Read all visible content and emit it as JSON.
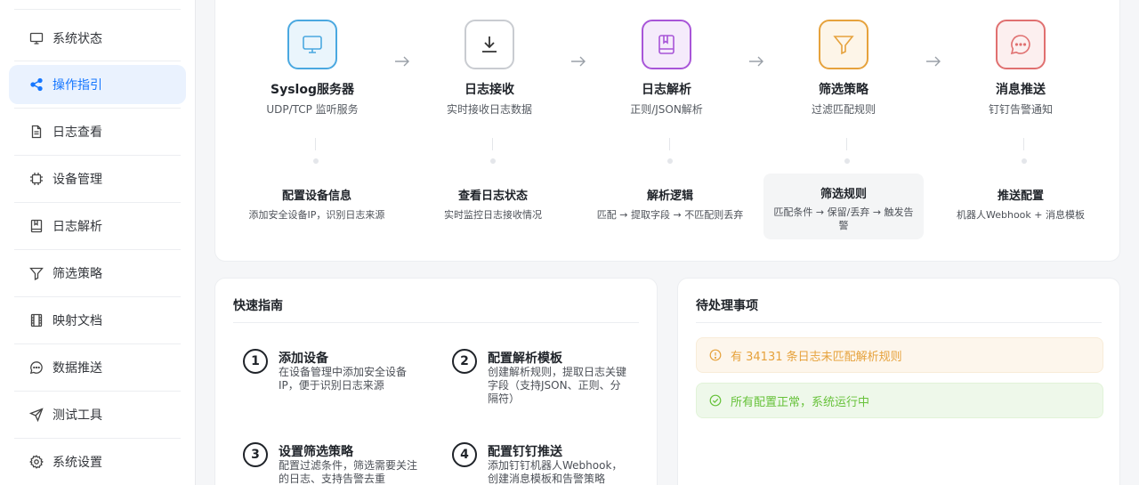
{
  "sidebar": {
    "items": [
      {
        "label": "系统状态",
        "icon": "monitor-icon",
        "active": false
      },
      {
        "label": "操作指引",
        "icon": "share-icon",
        "active": true
      },
      {
        "label": "日志查看",
        "icon": "document-icon",
        "active": false
      },
      {
        "label": "设备管理",
        "icon": "chip-icon",
        "active": false
      },
      {
        "label": "日志解析",
        "icon": "book-icon",
        "active": false
      },
      {
        "label": "筛选策略",
        "icon": "filter-icon",
        "active": false
      },
      {
        "label": "映射文档",
        "icon": "film-icon",
        "active": false
      },
      {
        "label": "数据推送",
        "icon": "chat-icon",
        "active": false
      },
      {
        "label": "测试工具",
        "icon": "send-icon",
        "active": false
      },
      {
        "label": "系统设置",
        "icon": "gear-icon",
        "active": false
      }
    ],
    "accent": "#1677ff",
    "active_bg": "#eaf2fe"
  },
  "flow": {
    "steps": [
      {
        "title": "Syslog服务器",
        "subtitle": "UDP/TCP 监听服务",
        "icon": "monitor-icon",
        "color": "#4aa8e0",
        "bg": "#eaf5fc"
      },
      {
        "title": "日志接收",
        "subtitle": "实时接收日志数据",
        "icon": "download-icon",
        "color": "#c9ccd1",
        "bg": "#ffffff"
      },
      {
        "title": "日志解析",
        "subtitle": "正则/JSON解析",
        "icon": "book-icon",
        "color": "#a855d8",
        "bg": "#f5ebfb"
      },
      {
        "title": "筛选策略",
        "subtitle": "过滤匹配规则",
        "icon": "filter-icon",
        "color": "#e6a23c",
        "bg": "#fdf5e8"
      },
      {
        "title": "消息推送",
        "subtitle": "钉钉告警通知",
        "icon": "chat-icon",
        "color": "#e07070",
        "bg": "#fcefef"
      }
    ],
    "details": [
      {
        "title": "配置设备信息",
        "desc": "添加安全设备IP，识别日志来源",
        "highlight": false
      },
      {
        "title": "查看日志状态",
        "desc": "实时监控日志接收情况",
        "highlight": false
      },
      {
        "title": "解析逻辑",
        "desc": "匹配 → 提取字段 → 不匹配则丢弃",
        "highlight": false
      },
      {
        "title": "筛选规则",
        "desc": "匹配条件 → 保留/丢弃 → 触发告警",
        "highlight": true
      },
      {
        "title": "推送配置",
        "desc": "机器人Webhook + 消息模板",
        "highlight": false
      }
    ]
  },
  "guide": {
    "title": "快速指南",
    "items": [
      {
        "num": "1",
        "title": "添加设备",
        "desc": "在设备管理中添加安全设备IP，便于识别日志来源"
      },
      {
        "num": "2",
        "title": "配置解析模板",
        "desc": "创建解析规则，提取日志关键字段（支持JSON、正则、分隔符）"
      },
      {
        "num": "3",
        "title": "设置筛选策略",
        "desc": "配置过滤条件，筛选需要关注的日志、支持告警去重"
      },
      {
        "num": "4",
        "title": "配置钉钉推送",
        "desc": "添加钉钉机器人Webhook，创建消息模板和告警策略"
      }
    ]
  },
  "todo": {
    "title": "待处理事项",
    "warning": {
      "text": "有 34131 条日志未匹配解析规则",
      "icon": "info-circle-icon",
      "color": "#e6a23c"
    },
    "ok": {
      "text": "所有配置正常，系统运行中",
      "icon": "check-circle-icon",
      "color": "#67c23a"
    }
  }
}
